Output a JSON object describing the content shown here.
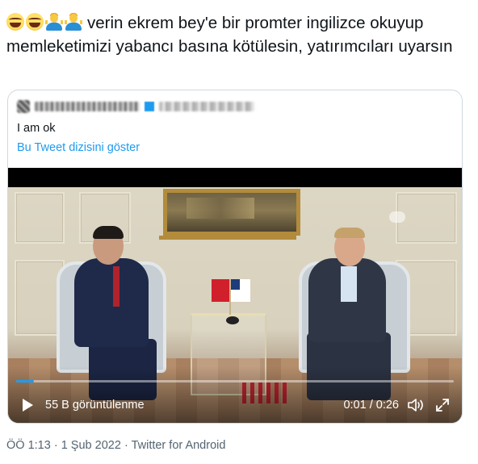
{
  "tweet": {
    "emojis": [
      "face-with-tears-of-joy-icon",
      "face-with-tears-of-joy-icon",
      "person-shrugging-icon",
      "person-shrugging-icon"
    ],
    "text": "verin ekrem bey'e bir promter ingilizce okuyup memleketimizi yabancı basına kötülesin, yatırımcıları uyarsın"
  },
  "quoted_tweet": {
    "text": "I am ok",
    "show_thread_link": "Bu Tweet dizisini göster"
  },
  "video": {
    "views": "55 B görüntülenme",
    "time": "0:01 / 0:26",
    "progress": 0.04,
    "accent_color": "#1d9bf0"
  },
  "meta": {
    "time": "ÖÖ 1:13",
    "separator1": "·",
    "date": "1 Şub 2022",
    "separator2": "·",
    "source": "Twitter for Android"
  }
}
